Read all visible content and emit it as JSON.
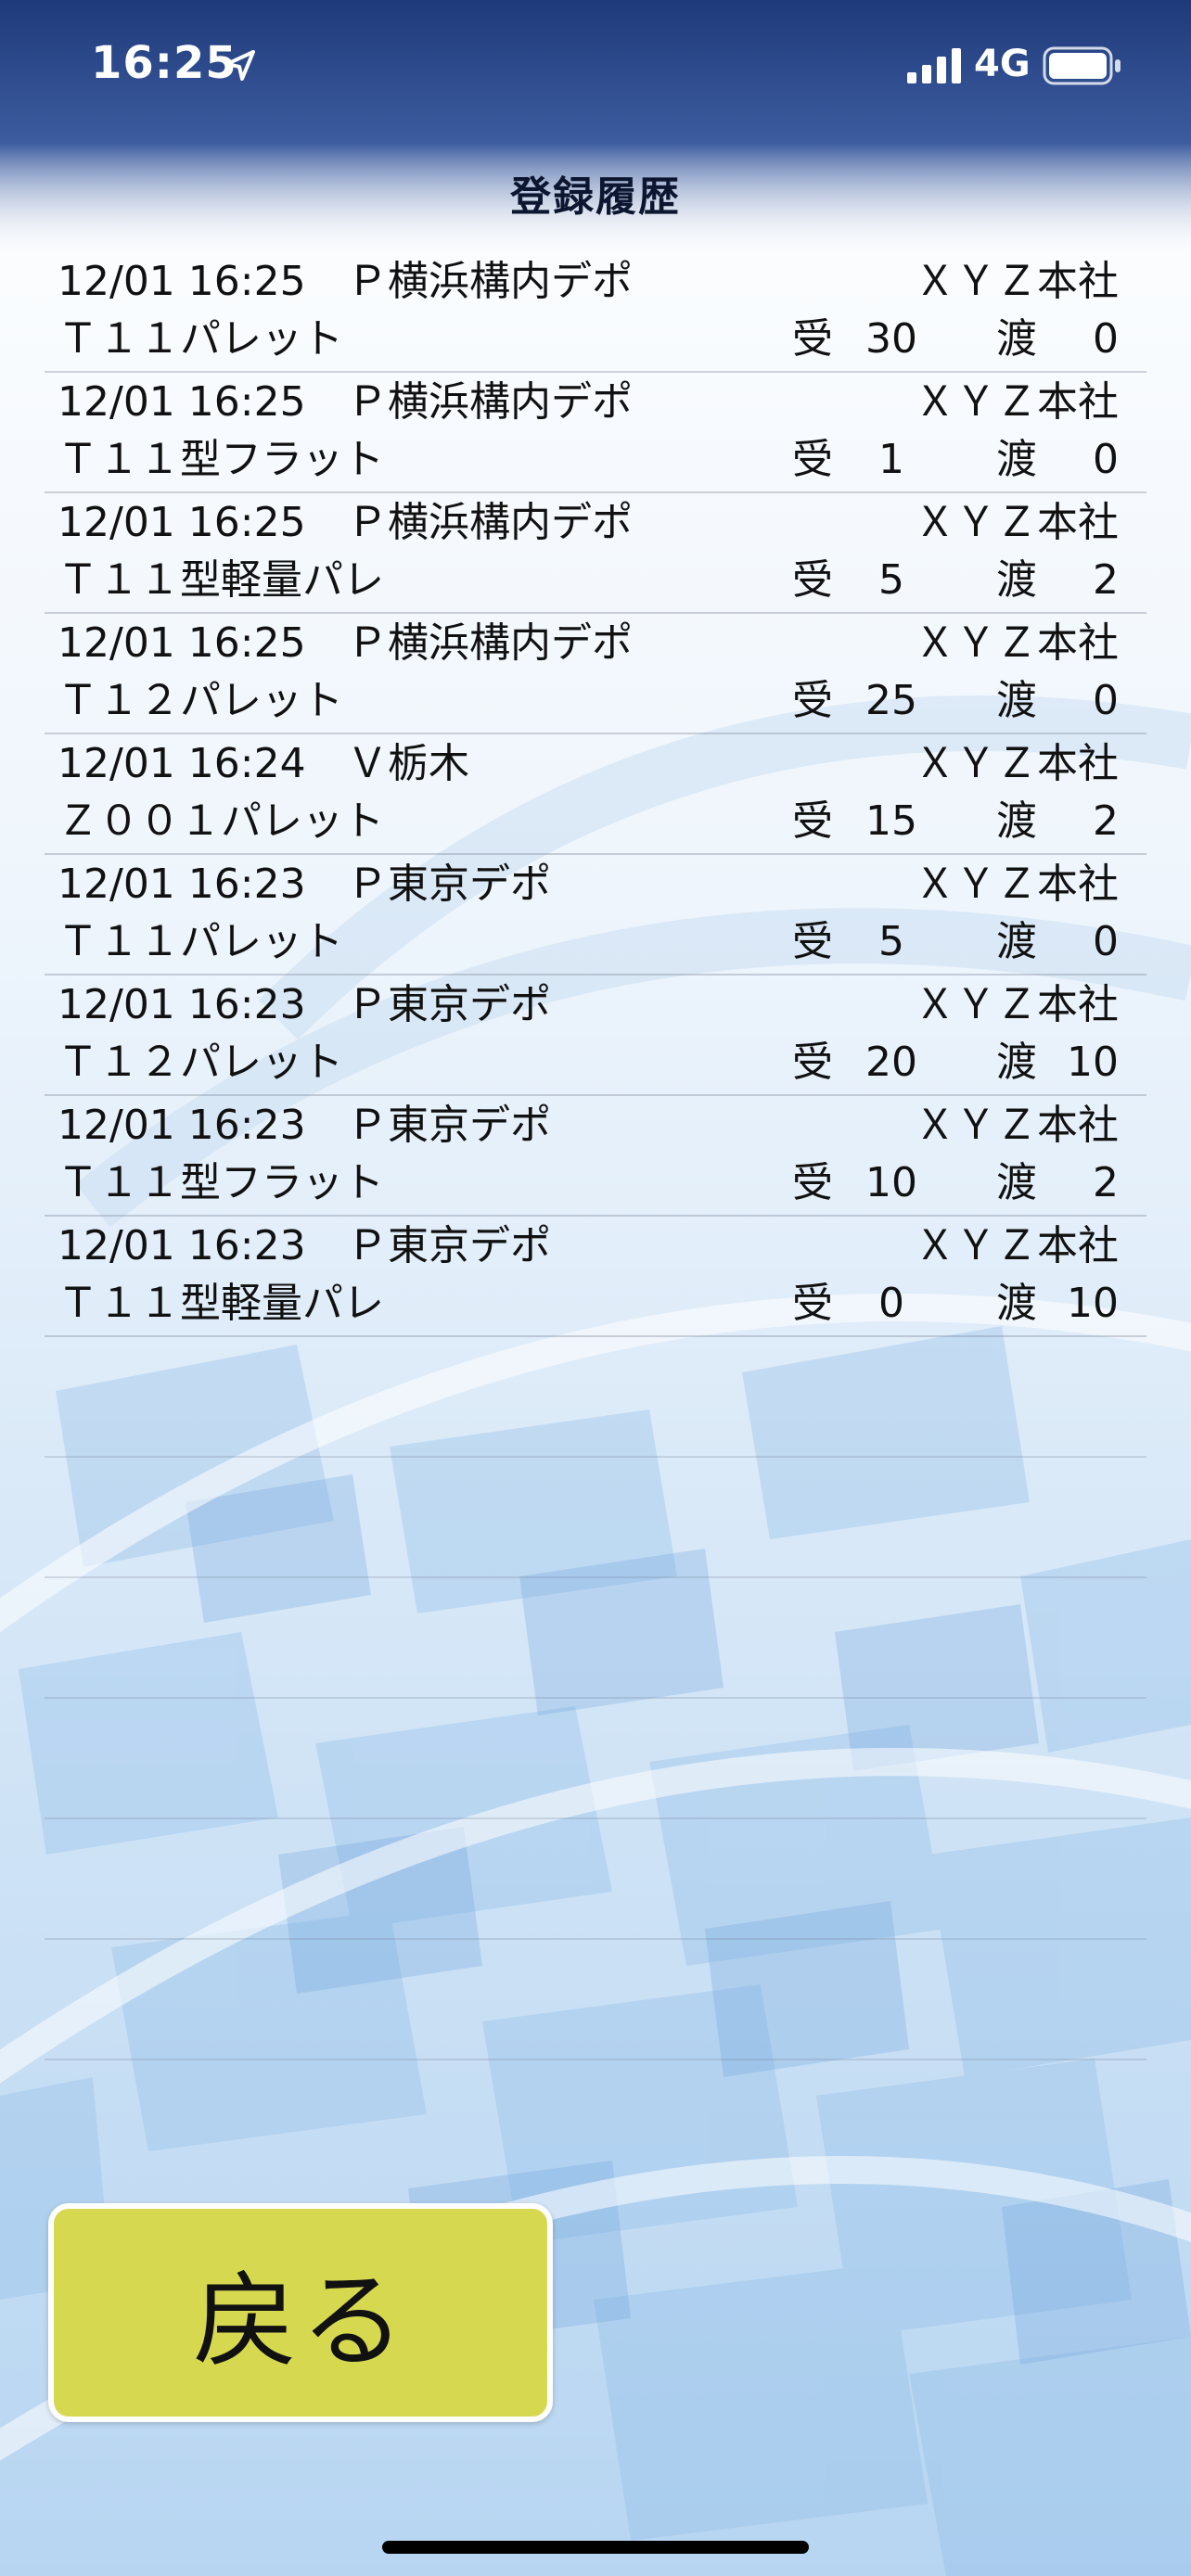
{
  "status_bar": {
    "time": "16:25",
    "network": "4G",
    "icons": [
      "location-arrow-icon",
      "signal-icon",
      "battery-icon"
    ]
  },
  "header": {
    "title": "登録履歴"
  },
  "history": {
    "labels": {
      "receive": "受",
      "deliver": "渡"
    },
    "entries": [
      {
        "time": "12/01 16:25",
        "from": "Ｐ横浜構内デポ",
        "to": "ＸＹＺ本社",
        "item": "Ｔ１１パレット",
        "received": "30",
        "delivered": "0"
      },
      {
        "time": "12/01 16:25",
        "from": "Ｐ横浜構内デポ",
        "to": "ＸＹＺ本社",
        "item": "Ｔ１１型フラット",
        "received": "1",
        "delivered": "0"
      },
      {
        "time": "12/01 16:25",
        "from": "Ｐ横浜構内デポ",
        "to": "ＸＹＺ本社",
        "item": "Ｔ１１型軽量パレ",
        "received": "5",
        "delivered": "2"
      },
      {
        "time": "12/01 16:25",
        "from": "Ｐ横浜構内デポ",
        "to": "ＸＹＺ本社",
        "item": "Ｔ１２パレット",
        "received": "25",
        "delivered": "0"
      },
      {
        "time": "12/01 16:24",
        "from": "Ｖ栃木",
        "to": "ＸＹＺ本社",
        "item": "Ｚ００１パレット",
        "received": "15",
        "delivered": "2"
      },
      {
        "time": "12/01 16:23",
        "from": "Ｐ東京デポ",
        "to": "ＸＹＺ本社",
        "item": "Ｔ１１パレット",
        "received": "5",
        "delivered": "0"
      },
      {
        "time": "12/01 16:23",
        "from": "Ｐ東京デポ",
        "to": "ＸＹＺ本社",
        "item": "Ｔ１２パレット",
        "received": "20",
        "delivered": "10"
      },
      {
        "time": "12/01 16:23",
        "from": "Ｐ東京デポ",
        "to": "ＸＹＺ本社",
        "item": "Ｔ１１型フラット",
        "received": "10",
        "delivered": "2"
      },
      {
        "time": "12/01 16:23",
        "from": "Ｐ東京デポ",
        "to": "ＸＹＺ本社",
        "item": "Ｔ１１型軽量パレ",
        "received": "0",
        "delivered": "10"
      }
    ]
  },
  "footer": {
    "back_label": "戻る"
  },
  "colors": {
    "header_top": "#1f3a7a",
    "button_fill": "#d6d94f",
    "background_accent": "#9cc4ea"
  }
}
